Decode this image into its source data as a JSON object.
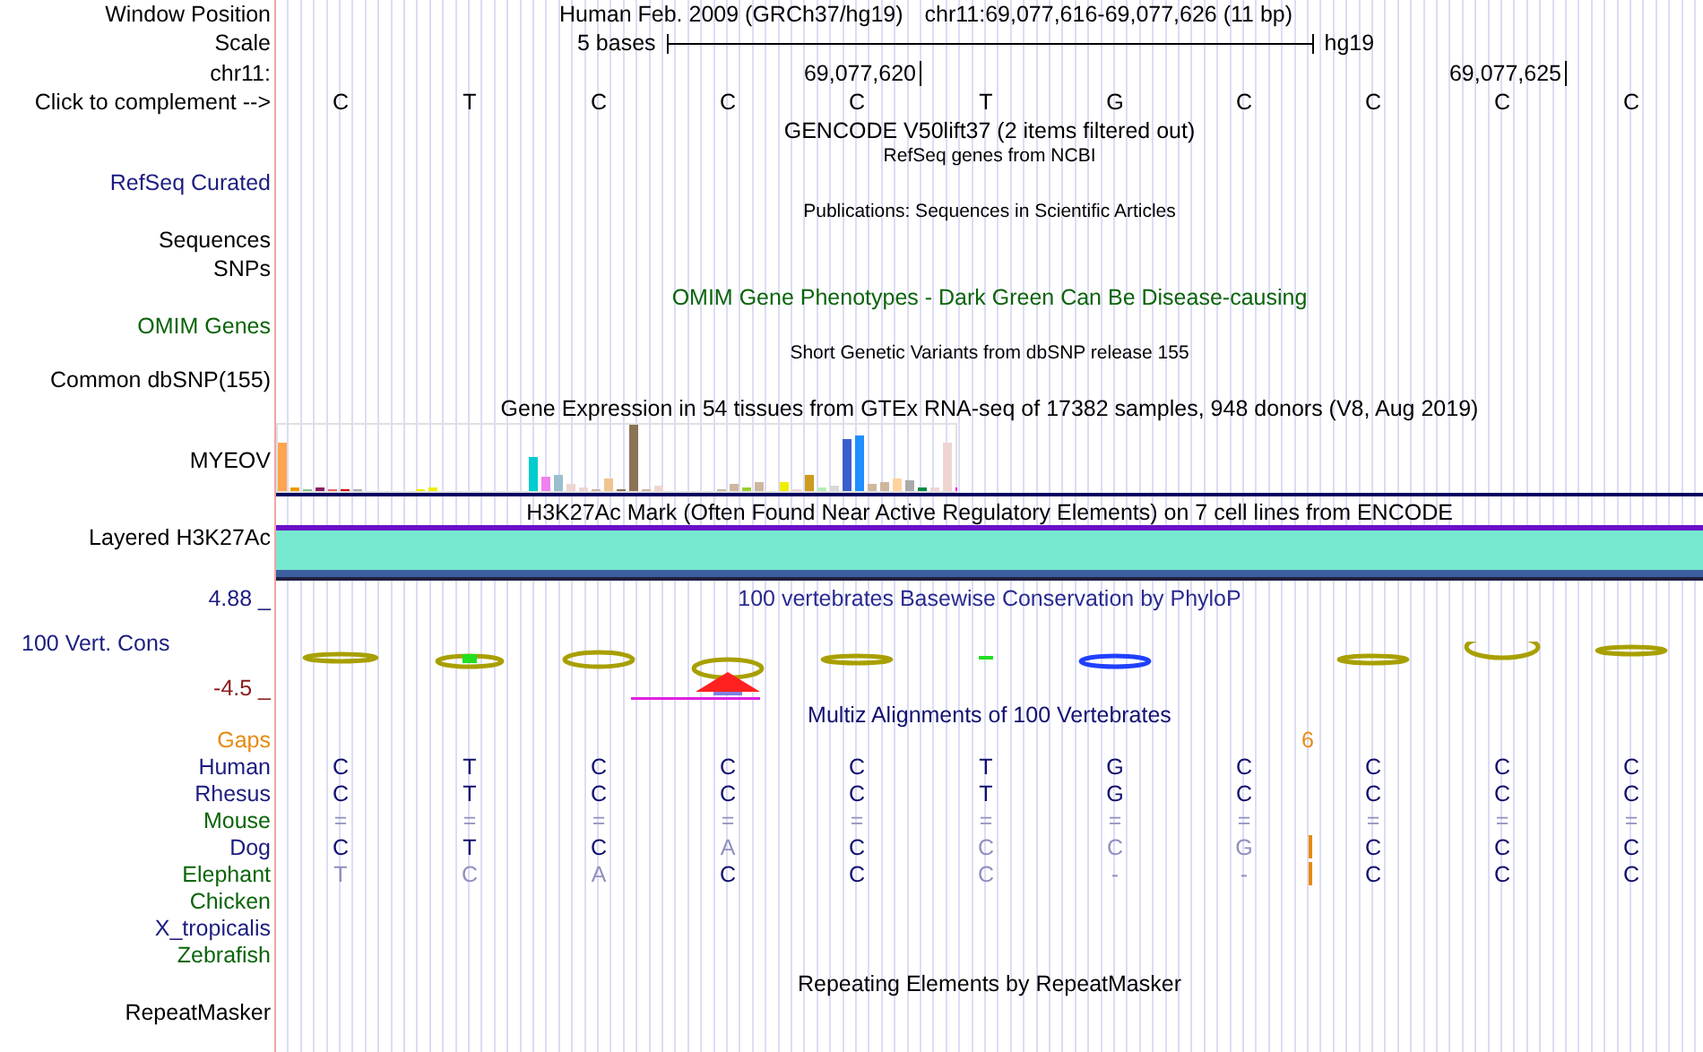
{
  "header": {
    "assembly": "Human Feb. 2009 (GRCh37/hg19)",
    "position": "chr11:69,077,616-69,077,626 (11 bp)"
  },
  "ruler": {
    "window_label": "Window Position",
    "scale_label": "Scale",
    "scale_text": "5 bases",
    "scale_assembly": "hg19",
    "chrom_label": "chr11:",
    "ticks": [
      "69,077,620",
      "69,077,625"
    ],
    "complement_label": "Click to complement -->",
    "bases": [
      "C",
      "T",
      "C",
      "C",
      "C",
      "T",
      "G",
      "C",
      "C",
      "C",
      "C"
    ]
  },
  "gencode": {
    "title": "GENCODE V50lift37 (2 items filtered out)"
  },
  "refseq": {
    "subtitle": "RefSeq genes from NCBI",
    "label": "RefSeq Curated"
  },
  "publications": {
    "subtitle": "Publications: Sequences in Scientific Articles",
    "label": "Sequences"
  },
  "snps": {
    "label": "SNPs"
  },
  "omim": {
    "title": "OMIM Gene Phenotypes - Dark Green Can Be Disease-causing",
    "label": "OMIM Genes"
  },
  "dbsnp": {
    "subtitle": "Short Genetic Variants from dbSNP release 155",
    "label": "Common dbSNP(155)"
  },
  "gtex": {
    "title": "Gene Expression in 54 tissues from GTEx RNA-seq of 17382 samples, 948 donors (V8, Aug 2019)",
    "label": "MYEOV"
  },
  "h3k27ac": {
    "title": "H3K27Ac Mark (Often Found Near Active Regulatory Elements) on 7 cell lines from ENCODE",
    "label": "Layered H3K27Ac"
  },
  "phylop": {
    "title": "100 vertebrates Basewise Conservation by PhyloP",
    "label": "100 Vert. Cons",
    "max": "4.88 _",
    "min": "-4.5 _"
  },
  "multiz": {
    "title": "Multiz Alignments of 100 Vertebrates",
    "gaps_label": "Gaps",
    "gap_count": "6",
    "species": [
      {
        "name": "Human",
        "color": "#1c1c80",
        "insertion": false,
        "bases": [
          {
            "b": "C",
            "faded": false
          },
          {
            "b": "T",
            "faded": false
          },
          {
            "b": "C",
            "faded": false
          },
          {
            "b": "C",
            "faded": false
          },
          {
            "b": "C",
            "faded": false
          },
          {
            "b": "T",
            "faded": false
          },
          {
            "b": "G",
            "faded": false
          },
          {
            "b": "C",
            "faded": false
          },
          {
            "b": "C",
            "faded": false
          },
          {
            "b": "C",
            "faded": false
          },
          {
            "b": "C",
            "faded": false
          }
        ]
      },
      {
        "name": "Rhesus",
        "color": "#1c1c80",
        "insertion": false,
        "bases": [
          {
            "b": "C",
            "faded": false
          },
          {
            "b": "T",
            "faded": false
          },
          {
            "b": "C",
            "faded": false
          },
          {
            "b": "C",
            "faded": false
          },
          {
            "b": "C",
            "faded": false
          },
          {
            "b": "T",
            "faded": false
          },
          {
            "b": "G",
            "faded": false
          },
          {
            "b": "C",
            "faded": false
          },
          {
            "b": "C",
            "faded": false
          },
          {
            "b": "C",
            "faded": false
          },
          {
            "b": "C",
            "faded": false
          }
        ]
      },
      {
        "name": "Mouse",
        "color": "#0a640a",
        "insertion": false,
        "bases": [
          {
            "b": "=",
            "faded": true
          },
          {
            "b": "=",
            "faded": true
          },
          {
            "b": "=",
            "faded": true
          },
          {
            "b": "=",
            "faded": true
          },
          {
            "b": "=",
            "faded": true
          },
          {
            "b": "=",
            "faded": true
          },
          {
            "b": "=",
            "faded": true
          },
          {
            "b": "=",
            "faded": true
          },
          {
            "b": "=",
            "faded": true
          },
          {
            "b": "=",
            "faded": true
          },
          {
            "b": "=",
            "faded": true
          }
        ]
      },
      {
        "name": "Dog",
        "color": "#1c1c80",
        "insertion": true,
        "bases": [
          {
            "b": "C",
            "faded": false
          },
          {
            "b": "T",
            "faded": false
          },
          {
            "b": "C",
            "faded": false
          },
          {
            "b": "A",
            "faded": true
          },
          {
            "b": "C",
            "faded": false
          },
          {
            "b": "C",
            "faded": true
          },
          {
            "b": "C",
            "faded": true
          },
          {
            "b": "G",
            "faded": true
          },
          {
            "b": "C",
            "faded": false
          },
          {
            "b": "C",
            "faded": false
          },
          {
            "b": "C",
            "faded": false
          }
        ]
      },
      {
        "name": "Elephant",
        "color": "#0a640a",
        "insertion": true,
        "bases": [
          {
            "b": "T",
            "faded": true
          },
          {
            "b": "C",
            "faded": true
          },
          {
            "b": "A",
            "faded": true
          },
          {
            "b": "C",
            "faded": false
          },
          {
            "b": "C",
            "faded": false
          },
          {
            "b": "C",
            "faded": true
          },
          {
            "b": "-",
            "faded": true
          },
          {
            "b": "-",
            "faded": true
          },
          {
            "b": "C",
            "faded": false
          },
          {
            "b": "C",
            "faded": false
          },
          {
            "b": "C",
            "faded": false
          }
        ]
      },
      {
        "name": "Chicken",
        "color": "#0a640a",
        "insertion": false
      },
      {
        "name": "X_tropicalis",
        "color": "#1c1c80",
        "insertion": false
      },
      {
        "name": "Zebrafish",
        "color": "#0a640a",
        "insertion": false
      }
    ]
  },
  "repeatmasker": {
    "title": "Repeating Elements by RepeatMasker",
    "label": "RepeatMasker"
  }
}
